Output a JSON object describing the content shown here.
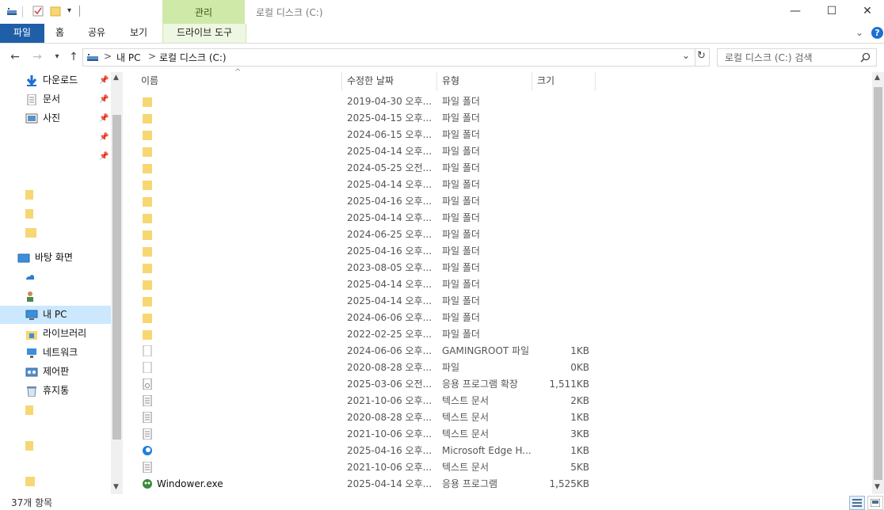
{
  "window": {
    "title": "로컬 디스크 (C:)",
    "context_tab": "관리",
    "minimize": "—",
    "maximize": "☐",
    "close": "✕"
  },
  "ribbon": {
    "file": "파일",
    "home": "홈",
    "share": "공유",
    "view": "보기",
    "drive_tools": "드라이브 도구"
  },
  "address": {
    "this_pc": "내 PC",
    "separator": ">",
    "location": "로컬 디스크 (C:)"
  },
  "search": {
    "placeholder": "로컬 디스크 (C:) 검색"
  },
  "nav": {
    "quick_access": [
      {
        "label": "다운로드",
        "icon": "download-arrow-icon"
      },
      {
        "label": "문서",
        "icon": "document-icon"
      },
      {
        "label": "사진",
        "icon": "pictures-icon"
      }
    ],
    "desktop": "바탕 화면",
    "this_pc": "내 PC",
    "libraries": "라이브러리",
    "network": "네트워크",
    "control_panel": "제어판",
    "recycle_bin": "휴지통"
  },
  "columns": {
    "name": "이름",
    "modified": "수정한 날짜",
    "type": "유형",
    "size": "크기"
  },
  "files": [
    {
      "name": "",
      "date": "2019-04-30 오후...",
      "type": "파일 폴더",
      "size": "",
      "icon": "folder-icon"
    },
    {
      "name": "",
      "date": "2025-04-15 오후...",
      "type": "파일 폴더",
      "size": "",
      "icon": "folder-icon"
    },
    {
      "name": "",
      "date": "2024-06-15 오후...",
      "type": "파일 폴더",
      "size": "",
      "icon": "folder-icon"
    },
    {
      "name": "",
      "date": "2025-04-14 오후...",
      "type": "파일 폴더",
      "size": "",
      "icon": "folder-icon"
    },
    {
      "name": "",
      "date": "2024-05-25 오전...",
      "type": "파일 폴더",
      "size": "",
      "icon": "folder-icon"
    },
    {
      "name": "",
      "date": "2025-04-14 오후...",
      "type": "파일 폴더",
      "size": "",
      "icon": "folder-icon"
    },
    {
      "name": "",
      "date": "2025-04-16 오후...",
      "type": "파일 폴더",
      "size": "",
      "icon": "folder-icon"
    },
    {
      "name": "",
      "date": "2025-04-14 오후...",
      "type": "파일 폴더",
      "size": "",
      "icon": "folder-icon"
    },
    {
      "name": "",
      "date": "2024-06-25 오후...",
      "type": "파일 폴더",
      "size": "",
      "icon": "folder-icon"
    },
    {
      "name": "",
      "date": "2025-04-16 오후...",
      "type": "파일 폴더",
      "size": "",
      "icon": "folder-icon"
    },
    {
      "name": "",
      "date": "2023-08-05 오후...",
      "type": "파일 폴더",
      "size": "",
      "icon": "folder-icon"
    },
    {
      "name": "",
      "date": "2025-04-14 오후...",
      "type": "파일 폴더",
      "size": "",
      "icon": "folder-icon"
    },
    {
      "name": "",
      "date": "2025-04-14 오후...",
      "type": "파일 폴더",
      "size": "",
      "icon": "folder-icon"
    },
    {
      "name": "",
      "date": "2024-06-06 오후...",
      "type": "파일 폴더",
      "size": "",
      "icon": "folder-icon"
    },
    {
      "name": "",
      "date": "2022-02-25 오후...",
      "type": "파일 폴더",
      "size": "",
      "icon": "folder-icon"
    },
    {
      "name": "",
      "date": "2024-06-06 오후...",
      "type": "GAMINGROOT 파일",
      "size": "1KB",
      "icon": "file-icon"
    },
    {
      "name": "",
      "date": "2020-08-28 오후...",
      "type": "파일",
      "size": "0KB",
      "icon": "file-icon"
    },
    {
      "name": "",
      "date": "2025-03-06 오전...",
      "type": "응용 프로그램 확장",
      "size": "1,511KB",
      "icon": "dll-file-icon"
    },
    {
      "name": "",
      "date": "2021-10-06 오후...",
      "type": "텍스트 문서",
      "size": "2KB",
      "icon": "text-file-icon"
    },
    {
      "name": "",
      "date": "2020-08-28 오후...",
      "type": "텍스트 문서",
      "size": "1KB",
      "icon": "text-file-icon"
    },
    {
      "name": "",
      "date": "2021-10-06 오후...",
      "type": "텍스트 문서",
      "size": "3KB",
      "icon": "text-file-icon"
    },
    {
      "name": "",
      "date": "2025-04-16 오후...",
      "type": "Microsoft Edge H...",
      "size": "1KB",
      "icon": "edge-icon"
    },
    {
      "name": "",
      "date": "2021-10-06 오후...",
      "type": "텍스트 문서",
      "size": "5KB",
      "icon": "text-file-icon"
    },
    {
      "name": "Windower.exe",
      "date": "2025-04-14 오후...",
      "type": "응용 프로그램",
      "size": "1,525KB",
      "icon": "windower-app-icon"
    }
  ],
  "status": {
    "count": "37개 항목"
  },
  "colors": {
    "file_tab": "#1f5fa8",
    "context_tab": "#cfe9a8",
    "selection": "#cce8ff",
    "folder": "#f7d774"
  }
}
